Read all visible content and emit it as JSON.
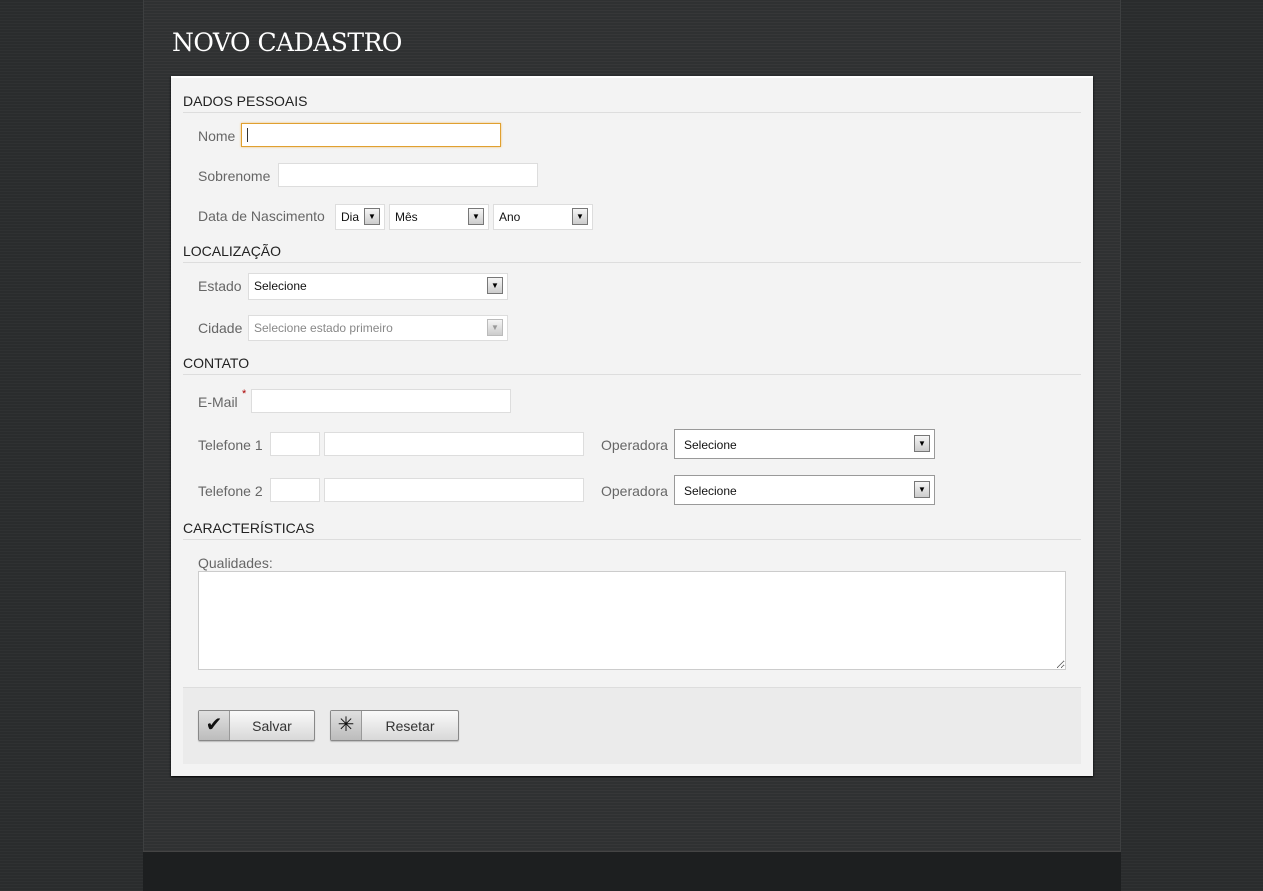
{
  "title": "NOVO CADASTRO",
  "sections": {
    "personal": "DADOS PESSOAIS",
    "location": "LOCALIZAÇÃO",
    "contact": "CONTATO",
    "traits": "CARACTERÍSTICAS"
  },
  "fields": {
    "nome": {
      "label": "Nome",
      "value": ""
    },
    "sobrenome": {
      "label": "Sobrenome",
      "value": ""
    },
    "nascimento": {
      "label": "Data de Nascimento",
      "dia": "Dia",
      "mes": "Mês",
      "ano": "Ano"
    },
    "estado": {
      "label": "Estado",
      "selected": "Selecione"
    },
    "cidade": {
      "label": "Cidade",
      "selected": "Selecione estado primeiro"
    },
    "email": {
      "label": "E-Mail",
      "required": "*",
      "value": ""
    },
    "telefone1": {
      "label": "Telefone 1",
      "operadora_label": "Operadora",
      "operadora": "Selecione"
    },
    "telefone2": {
      "label": "Telefone 2",
      "operadora_label": "Operadora",
      "operadora": "Selecione"
    },
    "qualidades": {
      "label": "Qualidades:",
      "value": ""
    }
  },
  "buttons": {
    "save": "Salvar",
    "reset": "Resetar",
    "save_icon": "checkmark-icon",
    "reset_icon": "asterisk-icon"
  },
  "colors": {
    "focus": "#e0a030",
    "required": "#aa0000"
  }
}
